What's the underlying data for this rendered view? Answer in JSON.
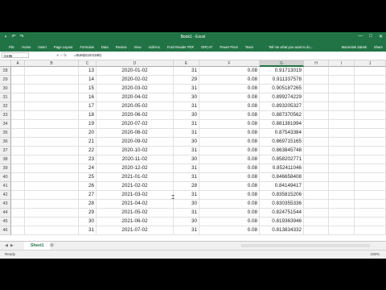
{
  "window": {
    "title": "Book1 - Excel",
    "controls": [
      "—",
      "□",
      "✕"
    ]
  },
  "ribbon": {
    "tabs": [
      "File",
      "Home",
      "Insert",
      "Page Layout",
      "Formulas",
      "Data",
      "Review",
      "View",
      "Add-ins",
      "Foxit Reader PDF",
      "DRCAT",
      "Power Pivot",
      "Team"
    ],
    "tell_me": "Tell me what you want to do...",
    "user": "Marmelak Sabeti",
    "share": "Share"
  },
  "formula_bar": {
    "name_box": "G196",
    "formula": "=SUM(G10:G190)"
  },
  "columns": [
    "A",
    "B",
    "C",
    "D",
    "E",
    "F",
    "G",
    "H",
    "I",
    "J"
  ],
  "rows": [
    {
      "n": "28",
      "c": "13",
      "d": "2020-01-02",
      "e": "31",
      "f": "0.08",
      "g": "0.91713019"
    },
    {
      "n": "29",
      "c": "14",
      "d": "2020-02-02",
      "e": "29",
      "f": "0.08",
      "g": "0.911337578"
    },
    {
      "n": "30",
      "c": "15",
      "d": "2020-03-02",
      "e": "31",
      "f": "0.08",
      "g": "0.905187265"
    },
    {
      "n": "31",
      "c": "16",
      "d": "2020-04-02",
      "e": "30",
      "f": "0.08",
      "g": "0.899274229"
    },
    {
      "n": "32",
      "c": "17",
      "d": "2020-05-02",
      "e": "31",
      "f": "0.08",
      "g": "0.893205327"
    },
    {
      "n": "33",
      "c": "18",
      "d": "2020-06-02",
      "e": "30",
      "f": "0.08",
      "g": "0.887370562"
    },
    {
      "n": "34",
      "c": "19",
      "d": "2020-07-02",
      "e": "31",
      "f": "0.08",
      "g": "0.881381994"
    },
    {
      "n": "35",
      "c": "20",
      "d": "2020-08-02",
      "e": "31",
      "f": "0.08",
      "g": "0.87543384"
    },
    {
      "n": "36",
      "c": "21",
      "d": "2020-09-02",
      "e": "30",
      "f": "0.08",
      "g": "0.869715165"
    },
    {
      "n": "37",
      "c": "22",
      "d": "2020-10-02",
      "e": "31",
      "f": "0.08",
      "g": "0.863845748"
    },
    {
      "n": "38",
      "c": "23",
      "d": "2020-11-02",
      "e": "30",
      "f": "0.08",
      "g": "0.858202771"
    },
    {
      "n": "39",
      "c": "24",
      "d": "2020-12-02",
      "e": "31",
      "f": "0.08",
      "g": "0.852411046"
    },
    {
      "n": "40",
      "c": "25",
      "d": "2021-01-02",
      "e": "31",
      "f": "0.08",
      "g": "0.846658408"
    },
    {
      "n": "41",
      "c": "26",
      "d": "2021-02-02",
      "e": "28",
      "f": "0.08",
      "g": "0.84149417"
    },
    {
      "n": "42",
      "c": "27",
      "d": "2021-03-02",
      "e": "31",
      "f": "0.08",
      "g": "0.835815206"
    },
    {
      "n": "43",
      "c": "28",
      "d": "2021-04-02",
      "e": "30",
      "f": "0.08",
      "g": "0.830355336"
    },
    {
      "n": "44",
      "c": "29",
      "d": "2021-05-02",
      "e": "31",
      "f": "0.08",
      "g": "0.824751544"
    },
    {
      "n": "45",
      "c": "30",
      "d": "2021-06-02",
      "e": "30",
      "f": "0.08",
      "g": "0.819363946"
    },
    {
      "n": "46",
      "c": "31",
      "d": "2021-07-02",
      "e": "31",
      "f": "0.08",
      "g": "0.813834332"
    }
  ],
  "sheet_tabs": [
    "Sheet1"
  ],
  "status": {
    "ready": "Ready",
    "zoom": "100%"
  },
  "colors": {
    "excel_green": "#217346",
    "header_gray": "#f0f0f0"
  }
}
